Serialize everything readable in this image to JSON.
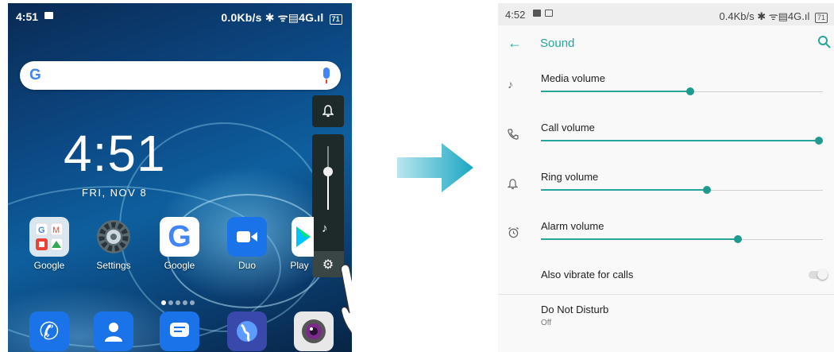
{
  "left_phone": {
    "status": {
      "time": "4:51",
      "right": "0.0Kb/s ✱ ᯤ▤4G.ıl",
      "battery": "71"
    },
    "search": {
      "logo": "G"
    },
    "clock": {
      "time": "4:51",
      "date": "FRI, NOV 8"
    },
    "volume_panel": {
      "level": 0.6
    },
    "apps": [
      {
        "name": "Google"
      },
      {
        "name": "Settings"
      },
      {
        "name": "Google"
      },
      {
        "name": "Duo"
      },
      {
        "name": "Play"
      }
    ],
    "colors": {
      "accent": "#26a69a"
    }
  },
  "right_phone": {
    "status": {
      "time": "4:52",
      "right": "0.4Kb/s ✱ ᯤ▤4G.ıl",
      "battery": "71"
    },
    "appbar": {
      "title": "Sound"
    },
    "volumes": [
      {
        "label": "Media volume",
        "icon": "music-note-icon",
        "level": 0.53
      },
      {
        "label": "Call volume",
        "icon": "phone-icon",
        "level": 1.0
      },
      {
        "label": "Ring volume",
        "icon": "bell-icon",
        "level": 0.59
      },
      {
        "label": "Alarm volume",
        "icon": "alarm-clock-icon",
        "level": 0.7
      }
    ],
    "vibrate": {
      "label": "Also vibrate for calls",
      "on": false
    },
    "dnd": {
      "label": "Do Not Disturb",
      "value": "Off"
    }
  }
}
